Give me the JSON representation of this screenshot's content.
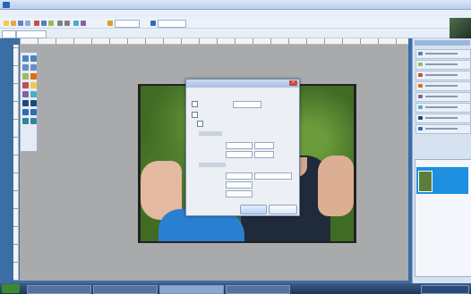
{
  "window": {},
  "menus": [],
  "toolbar": {},
  "dialog": {},
  "right_panel": {},
  "taskbar": {},
  "colors": {
    "accent": "#1e8fe0",
    "workspace": "#a9aaab",
    "dialog_bg": "#eceff4",
    "shirt_blue": "#2a7fd1",
    "foliage": "#3f6b24"
  },
  "icons": {
    "app": "paint-app-icon",
    "close": "close-icon",
    "start": "windows-start-icon"
  }
}
